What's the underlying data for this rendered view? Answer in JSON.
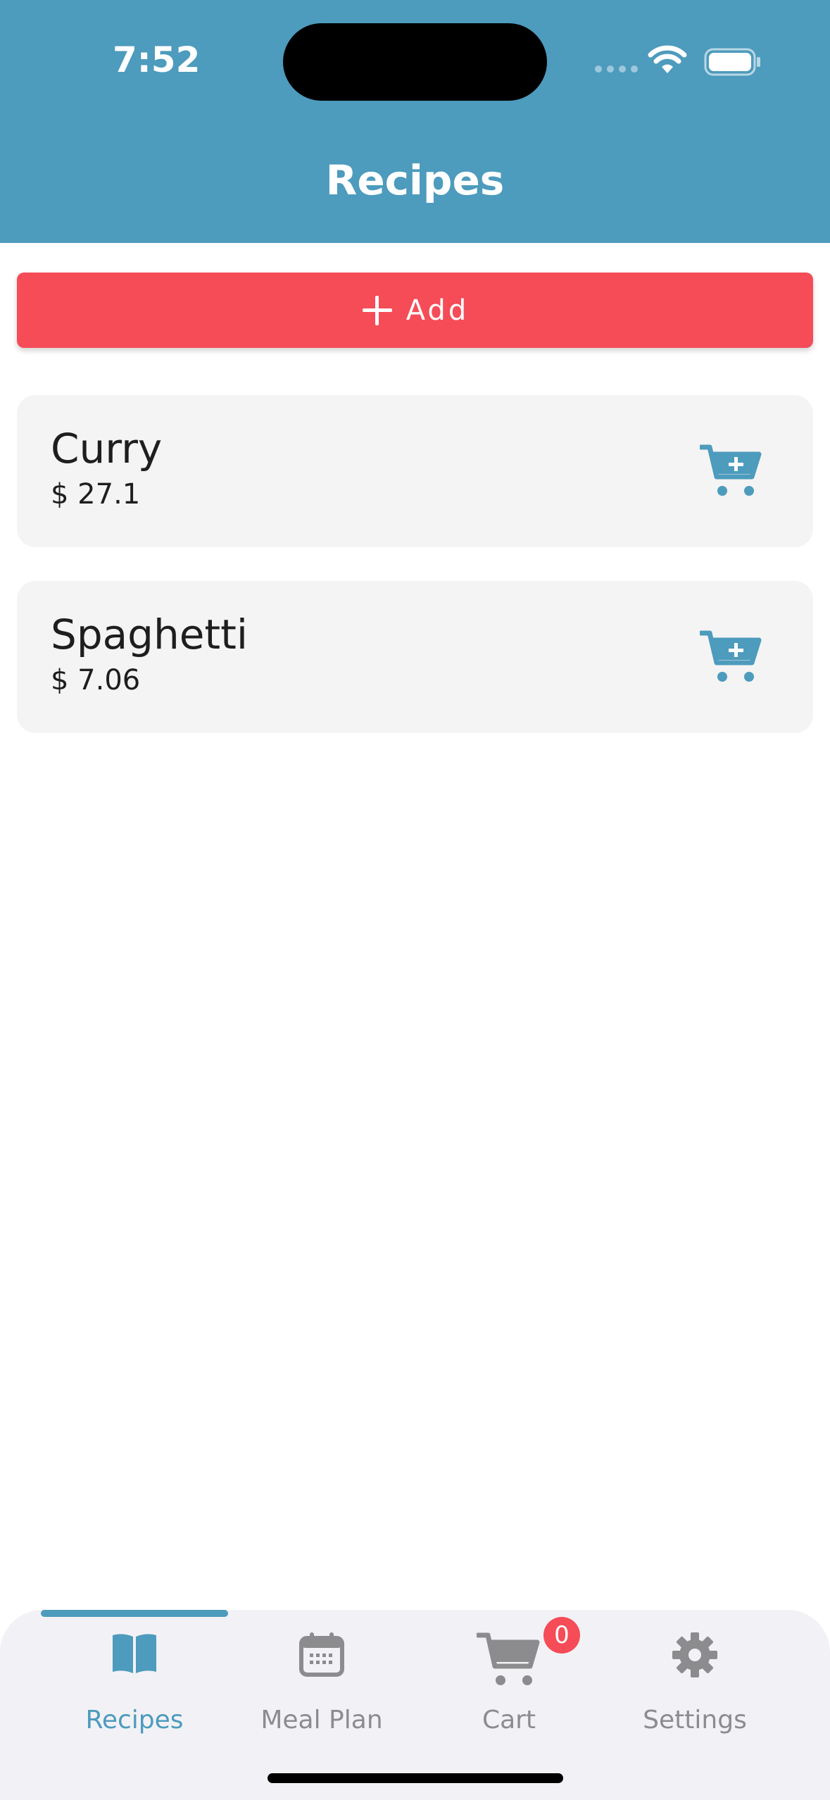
{
  "status_bar": {
    "time": "7:52"
  },
  "header": {
    "title": "Recipes"
  },
  "add_button": {
    "label": "Add",
    "icon": "plus-icon"
  },
  "recipes": [
    {
      "name": "Curry",
      "price": "$ 27.1",
      "action_icon": "cart-plus-icon"
    },
    {
      "name": "Spaghetti",
      "price": "$ 7.06",
      "action_icon": "cart-plus-icon"
    }
  ],
  "tab_bar": {
    "tabs": [
      {
        "label": "Recipes",
        "icon": "book-icon",
        "active": true
      },
      {
        "label": "Meal Plan",
        "icon": "calendar-icon",
        "active": false
      },
      {
        "label": "Cart",
        "icon": "cart-icon",
        "active": false,
        "badge": "0"
      },
      {
        "label": "Settings",
        "icon": "gear-icon",
        "active": false
      }
    ]
  },
  "colors": {
    "primary": "#4d9bbd",
    "accent": "#f54c58",
    "card": "#f4f4f4",
    "inactive": "#8c8c8f"
  }
}
